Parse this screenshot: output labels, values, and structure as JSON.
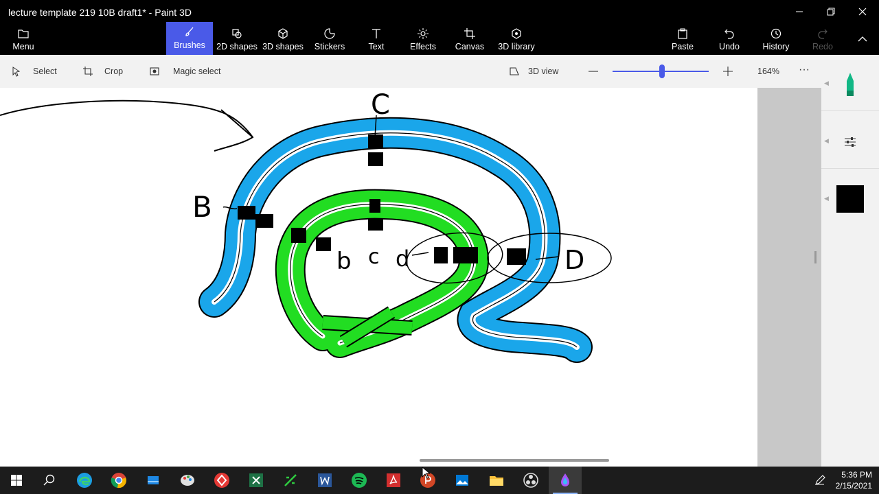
{
  "window": {
    "title": "lecture template 219 10B draft1* - Paint 3D"
  },
  "ribbon": {
    "menu": "Menu",
    "tools": [
      "Brushes",
      "2D shapes",
      "3D shapes",
      "Stickers",
      "Text",
      "Effects",
      "Canvas",
      "3D library"
    ],
    "paste": "Paste",
    "undo": "Undo",
    "history": "History",
    "redo": "Redo"
  },
  "toolbar": {
    "select": "Select",
    "crop": "Crop",
    "magic_select": "Magic select",
    "view_3d": "3D view",
    "zoom": "164%",
    "more": "···"
  },
  "drawing": {
    "labels": [
      "C",
      "B",
      "b",
      "c",
      "d",
      "D"
    ]
  },
  "colors": {
    "blue": "#1aa6ea",
    "green": "#22dd22",
    "accent": "#4a5ae8",
    "selected_color": "#000000"
  },
  "taskbar": {
    "apps": [
      "windows-start",
      "search",
      "edge",
      "chrome",
      "paint",
      "snip",
      "anydesk",
      "excel",
      "sourcetree",
      "word",
      "spotify",
      "acrobat",
      "powerpoint",
      "photos",
      "file-explorer",
      "obs",
      "paint-3d"
    ],
    "time": "5:36 PM",
    "date": "2/15/2021"
  }
}
